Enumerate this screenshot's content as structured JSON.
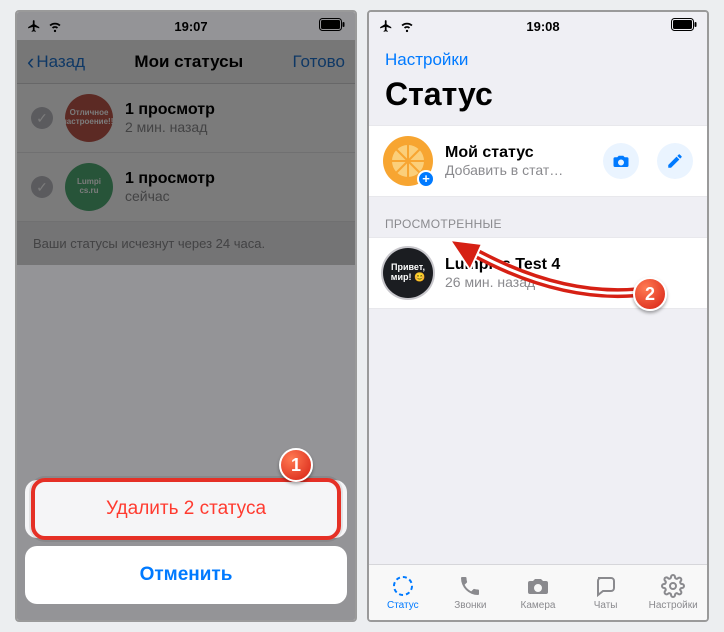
{
  "left": {
    "time": "19:07",
    "nav": {
      "back": "Назад",
      "title": "Мои статусы",
      "done": "Готово"
    },
    "rows": [
      {
        "thumb_text": "Отличное\nнастроение!!!",
        "title": "1 просмотр",
        "subtitle": "2 мин. назад"
      },
      {
        "thumb_text": "Lumpi\ncs.ru",
        "title": "1 просмотр",
        "subtitle": "сейчас"
      }
    ],
    "hint": "Ваши статусы исчезнут через 24 часа.",
    "sheet": {
      "delete": "Удалить 2 статуса",
      "cancel": "Отменить"
    }
  },
  "right": {
    "time": "19:08",
    "settings_link": "Настройки",
    "title": "Статус",
    "my_status": {
      "title": "Мой статус",
      "subtitle": "Добавить в стат…"
    },
    "section_viewed": "ПРОСМОТРЕННЫЕ",
    "viewed_row": {
      "thumb_text": "Привет,\nмир! 😊",
      "title": "Lumpics Test 4",
      "subtitle": "26 мин. назад"
    },
    "tabs": {
      "status": "Статус",
      "calls": "Звонки",
      "camera": "Камера",
      "chats": "Чаты",
      "settings": "Настройки"
    }
  },
  "badges": {
    "one": "1",
    "two": "2"
  }
}
